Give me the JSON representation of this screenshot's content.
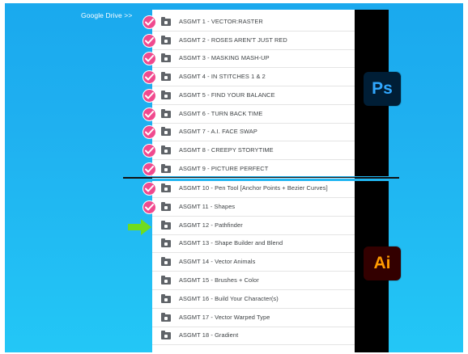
{
  "header": {
    "drive_link": "Google Drive >>"
  },
  "photoshop": {
    "icon_text": "Ps",
    "icon_name": "photoshop-icon",
    "bg_color": "#001e36",
    "fg_color": "#31a8ff",
    "assignments": [
      {
        "label": "ASGMT 1 - VECTOR:RASTER",
        "completed": true
      },
      {
        "label": "ASGMT 2 - ROSES AREN'T JUST RED",
        "completed": true
      },
      {
        "label": "ASGMT 3 - MASKING MASH-UP",
        "completed": true
      },
      {
        "label": "ASGMT 4 - IN STITCHES 1 & 2",
        "completed": true
      },
      {
        "label": "ASGMT 5 - FIND YOUR BALANCE",
        "completed": true
      },
      {
        "label": "ASGMT 6 - TURN BACK TIME",
        "completed": true
      },
      {
        "label": "ASGMT 7 - A.I. FACE SWAP",
        "completed": true
      },
      {
        "label": "ASGMT 8 - CREEPY STORYTIME",
        "completed": true
      },
      {
        "label": "ASGMT 9 - PICTURE PERFECT",
        "completed": true
      }
    ]
  },
  "illustrator": {
    "icon_text": "Ai",
    "icon_name": "illustrator-icon",
    "bg_color": "#330000",
    "fg_color": "#ff9a00",
    "assignments": [
      {
        "label": "ASGMT 10 - Pen Tool [Anchor Points + Bezier Curves]",
        "completed": true
      },
      {
        "label": "ASGMT 11 - Shapes",
        "completed": true
      },
      {
        "label": "ASGMT 12 - Pathfinder",
        "completed": false,
        "current": true
      },
      {
        "label": "ASGMT 13 - Shape Builder and Blend",
        "completed": false
      },
      {
        "label": "ASGMT 14 - Vector Animals",
        "completed": false
      },
      {
        "label": "ASGMT 15 - Brushes + Color",
        "completed": false
      },
      {
        "label": "ASGMT 16 - Build Your Character(s)",
        "completed": false
      },
      {
        "label": "ASGMT 17 - Vector Warped Type",
        "completed": false
      },
      {
        "label": "ASGMT 18 - Gradient",
        "completed": false
      }
    ]
  },
  "colors": {
    "check_pink": "#f04a8e",
    "arrow_green": "#6fdc1f",
    "background_blue": "#1fb0f0"
  },
  "icons": {
    "check": "check-icon",
    "folder": "shared-folder-icon",
    "arrow": "current-assignment-arrow-icon"
  }
}
